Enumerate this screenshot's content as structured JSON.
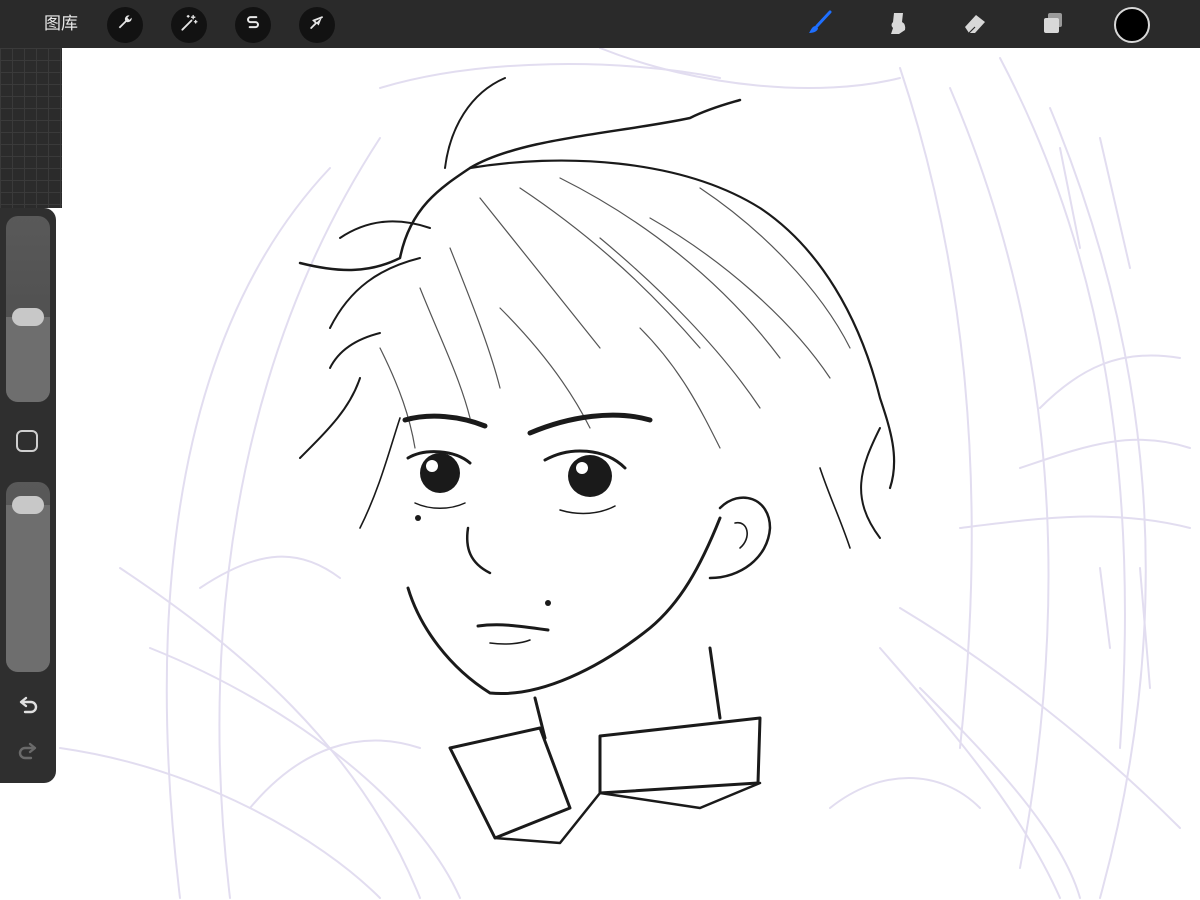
{
  "toolbar": {
    "gallery_label": "图库",
    "left_tools": [
      {
        "icon": "wrench-icon",
        "name": "actions"
      },
      {
        "icon": "magic-wand-icon",
        "name": "adjustments"
      },
      {
        "icon": "selection-icon",
        "name": "selection"
      },
      {
        "icon": "arrow-cursor-icon",
        "name": "transform"
      }
    ],
    "right_tools": [
      {
        "icon": "brush-icon",
        "name": "paint",
        "active": true
      },
      {
        "icon": "smudge-icon",
        "name": "smudge",
        "active": false
      },
      {
        "icon": "eraser-icon",
        "name": "eraser",
        "active": false
      },
      {
        "icon": "layers-icon",
        "name": "layers",
        "active": false
      }
    ],
    "current_color": "#000000",
    "active_color": "#1e6fff"
  },
  "sidebar": {
    "brush_size_level": 0.45,
    "opacity_level": 0.94,
    "icons": [
      "modifier-square-icon",
      "undo-icon",
      "redo-icon"
    ]
  },
  "canvas": {
    "sketch_line_color": "#e4e0f0",
    "ink_color": "#1a1a1a",
    "background": "#ffffff"
  }
}
